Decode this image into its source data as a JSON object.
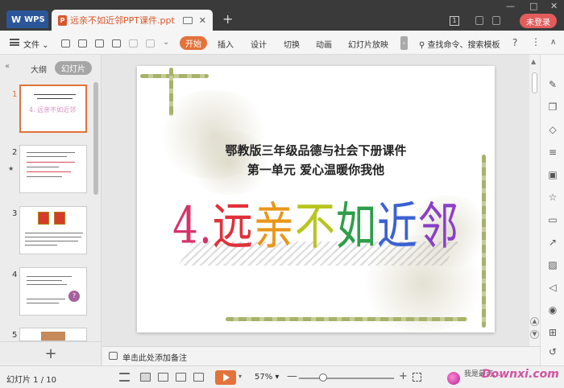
{
  "titlebar": {
    "app_tab": "WPS",
    "doc_tab": "远亲不如近邻PPT课件.ppt",
    "doc_icon": "P",
    "login": "未登录",
    "minimize": "—",
    "maximize": "□",
    "close": "✕"
  },
  "ribbon": {
    "file_menu": "文件",
    "tabs": [
      "开始",
      "插入",
      "设计",
      "切换",
      "动画",
      "幻灯片放映"
    ],
    "search": "查找命令、搜索模板",
    "help": "?",
    "more": "⋮",
    "collapse": "∧"
  },
  "left_panel": {
    "tab_outline": "大纲",
    "tab_slides": "幻灯片",
    "thumbnails": [
      {
        "num": "1",
        "title": "4. 远亲不如近邻"
      },
      {
        "num": "2"
      },
      {
        "num": "3"
      },
      {
        "num": "4"
      },
      {
        "num": "5"
      }
    ],
    "add": "+"
  },
  "slide": {
    "line1": "鄂教版三年级品德与社会下册课件",
    "line2": "第一单元 爱心温暖你我他",
    "title_chars": [
      "4",
      ".",
      "远",
      "亲",
      "不",
      "如",
      "近",
      "邻"
    ]
  },
  "notes": {
    "placeholder": "单击此处添加备注"
  },
  "status": {
    "slide_count": "幻灯片 1 / 10",
    "zoom": "57%",
    "zoom_level_percent": 25,
    "watermark_top": "我是最可…",
    "watermark": "Downxi.com"
  },
  "icons": {
    "theme_accent": "#e2733b",
    "login_color": "#e25c5c"
  }
}
